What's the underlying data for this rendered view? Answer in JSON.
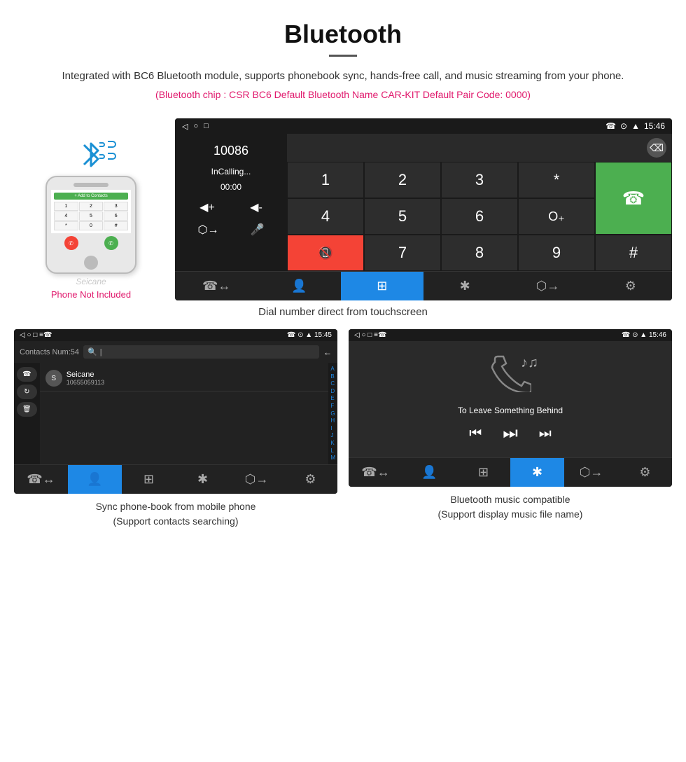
{
  "header": {
    "title": "Bluetooth",
    "description": "Integrated with BC6 Bluetooth module, supports phonebook sync, hands-free call, and music streaming from your phone.",
    "specs": "(Bluetooth chip : CSR BC6    Default Bluetooth Name CAR-KIT    Default Pair Code: 0000)"
  },
  "main_screen": {
    "status_bar": {
      "time": "15:46",
      "left_icons": [
        "◁",
        "○",
        "□"
      ],
      "right_icons": [
        "☎",
        "⊙",
        "▲"
      ]
    },
    "dialer": {
      "number": "10086",
      "status": "InCalling...",
      "timer": "00:00",
      "keys": [
        {
          "label": "1"
        },
        {
          "label": "2"
        },
        {
          "label": "3"
        },
        {
          "label": "*"
        },
        {
          "label": "4"
        },
        {
          "label": "5"
        },
        {
          "label": "6"
        },
        {
          "label": "O₊"
        },
        {
          "label": "7"
        },
        {
          "label": "8"
        },
        {
          "label": "9"
        },
        {
          "label": "#"
        }
      ]
    },
    "bottom_tabs": [
      {
        "icon": "☎",
        "active": false
      },
      {
        "icon": "👤",
        "active": false
      },
      {
        "icon": "⊞",
        "active": true
      },
      {
        "icon": "✱",
        "active": false
      },
      {
        "icon": "⬡",
        "active": false
      },
      {
        "icon": "⚙",
        "active": false
      }
    ]
  },
  "phone_mockup": {
    "label": "Phone Not Included",
    "screen_items": [
      "1",
      "2",
      "3",
      "4",
      "5",
      "6",
      "*",
      "0",
      "#"
    ]
  },
  "caption_main": "Dial number direct from touchscreen",
  "contacts_screen": {
    "status_bar": {
      "left": "◁  ○  □  ≡☎",
      "right": "☎ ⊙ ▲ 15:45"
    },
    "contacts_num": "Contacts Num:54",
    "search_placeholder": "🔍 |",
    "back_icon": "←",
    "contact": {
      "name": "Seicane",
      "phone": "10655059113"
    },
    "alpha_letters": [
      "A",
      "B",
      "C",
      "D",
      "E",
      "F",
      "G",
      "H",
      "I",
      "J",
      "K",
      "L",
      "M"
    ],
    "buttons": [
      "☎",
      "↻",
      "🗑"
    ],
    "bottom_tabs": [
      {
        "icon": "☎",
        "active": false
      },
      {
        "icon": "👤",
        "active": true
      },
      {
        "icon": "⊞",
        "active": false
      },
      {
        "icon": "✱",
        "active": false
      },
      {
        "icon": "⬡",
        "active": false
      },
      {
        "icon": "⚙",
        "active": false
      }
    ]
  },
  "music_screen": {
    "status_bar": {
      "left": "◁  ○  □  ≡☎",
      "right": "☎ ⊙ ▲ 15:46"
    },
    "song_title": "To Leave Something Behind",
    "controls": [
      "⏮",
      "⏭",
      "⏭"
    ],
    "bottom_tabs": [
      {
        "icon": "☎",
        "active": false
      },
      {
        "icon": "👤",
        "active": false
      },
      {
        "icon": "⊞",
        "active": false
      },
      {
        "icon": "✱",
        "active": true
      },
      {
        "icon": "⬡",
        "active": false
      },
      {
        "icon": "⚙",
        "active": false
      }
    ]
  },
  "caption_contacts": "Sync phone-book from mobile phone\n(Support contacts searching)",
  "caption_music": "Bluetooth music compatible\n(Support display music file name)"
}
